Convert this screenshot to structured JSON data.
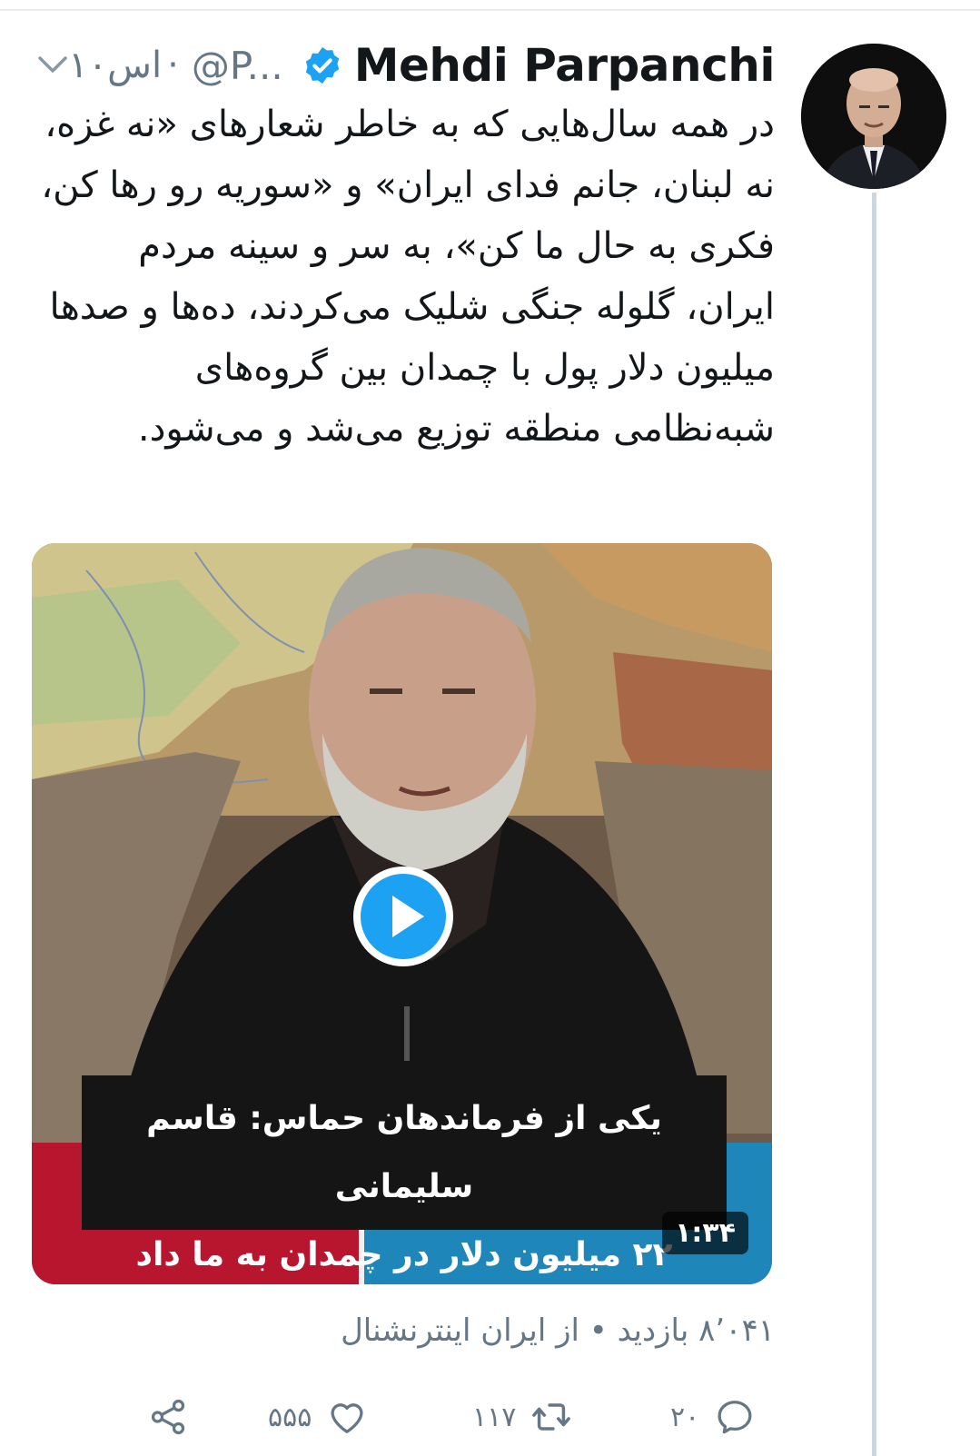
{
  "tweet": {
    "display_name": "Mehdi Parpanchi",
    "handle": "@P...",
    "separator": "·",
    "time": "۱۰اس",
    "text": "در همه سال‌هایی که به خاطر شعارهای «نه غزه، نه لبنان، جانم فدای ایران» و «سوریه رو رها کن، فکری به حال ما کن»، به سر و سینه مردم ایران، گلوله جنگی شلیک می‌کردند، ده‌ها و صدها میلیون دلار پول با چمدان بین گروه‌های شبه‌نظامی منطقه توزیع می‌شد و می‌شود.",
    "verified": true
  },
  "video": {
    "caption_line1": "یکی از فرماندهان حماس: قاسم سلیمانی",
    "caption_line2": "۲۲ میلیون دلار در چمدان به ما داد",
    "duration": "۱:۳۴"
  },
  "stats": {
    "views_line": "۸٬۰۴۱ بازدید • از ایران اینترنشنال"
  },
  "actions": {
    "reply_count": "۲۰",
    "retweet_count": "۱۱۷",
    "like_count": "۵۵۵"
  },
  "icons": {
    "verified": "verified-badge-icon",
    "play": "play-icon",
    "reply": "reply-icon",
    "retweet": "retweet-icon",
    "like": "heart-icon",
    "share": "share-icon",
    "caret": "chevron-down-icon"
  },
  "colors": {
    "accent": "#1da1f2",
    "muted": "#657786",
    "text": "#14171a"
  }
}
